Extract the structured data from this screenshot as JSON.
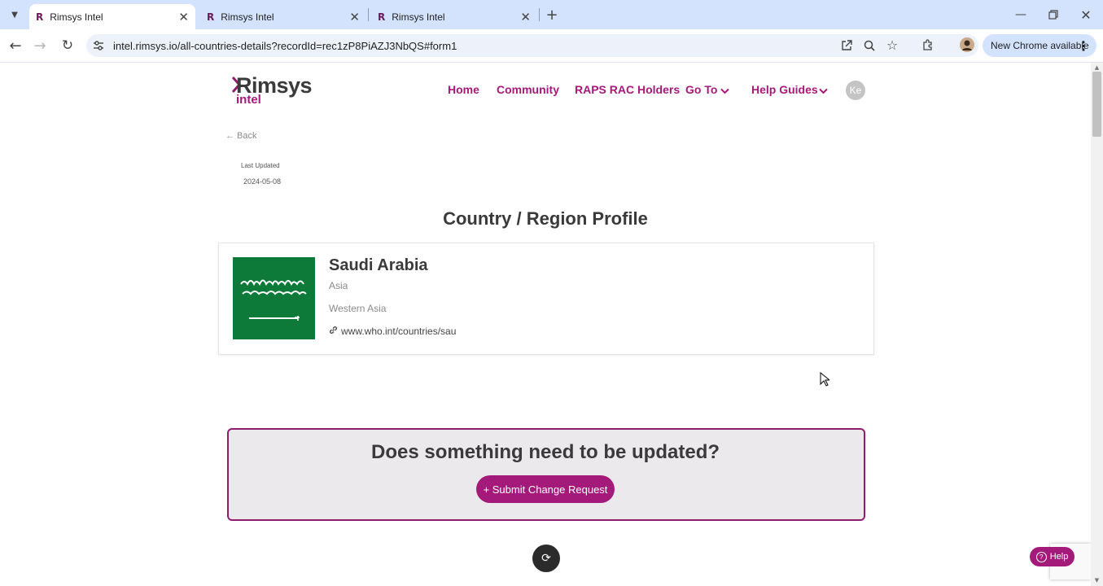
{
  "browser": {
    "tabs": [
      {
        "title": "Rimsys Intel",
        "active": true
      },
      {
        "title": "Rimsys Intel",
        "active": false
      },
      {
        "title": "Rimsys Intel",
        "active": false
      }
    ],
    "url": "intel.rimsys.io/all-countries-details?recordId=rec1zP8PiAZJ3NbQS#form1",
    "new_chrome_label": "New Chrome available"
  },
  "site": {
    "logo_main": "Rimsys",
    "logo_sub": "intel",
    "nav": {
      "home": "Home",
      "community": "Community",
      "raps": "RAPS RAC Holders",
      "goto": "Go To",
      "help_guides": "Help Guides"
    },
    "avatar_initials": "Ke"
  },
  "page": {
    "back_label": "← Back",
    "last_updated_label": "Last Updated",
    "last_updated_value": "2024-05-08",
    "heading": "Country / Region Profile",
    "country": {
      "name": "Saudi Arabia",
      "region": "Asia",
      "subregion": "Western Asia",
      "link": "www.who.int/countries/sau"
    },
    "update_heading": "Does something need to be updated?",
    "submit_label": "+ Submit Change Request",
    "help_label": "Help"
  },
  "colors": {
    "brand": "#a41a7a",
    "flag_green": "#0d7a3a"
  }
}
